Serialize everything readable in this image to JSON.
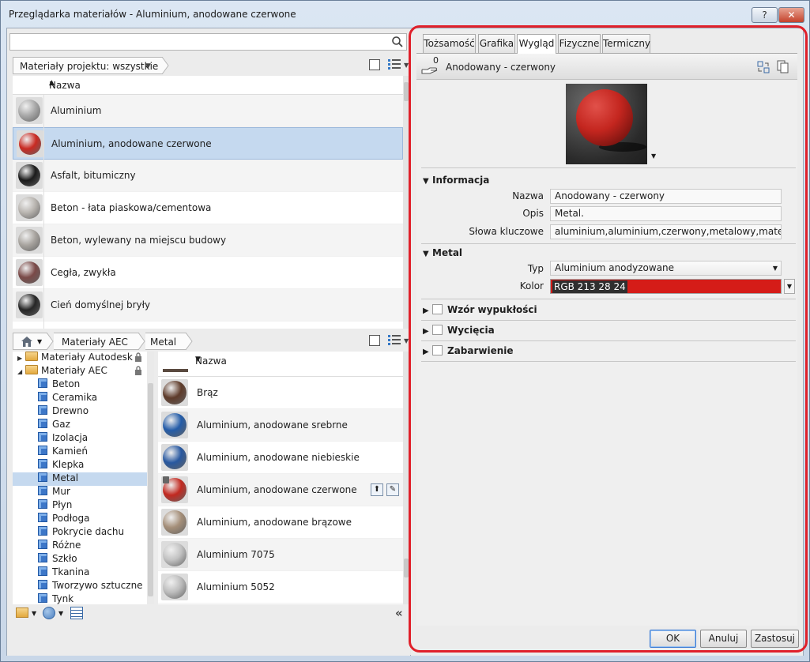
{
  "window": {
    "title": "Przeglądarka materiałów - Aluminium, anodowane czerwone",
    "help_label": "?",
    "close_label": "✕"
  },
  "search": {
    "placeholder": ""
  },
  "project_filter": {
    "label": "Materiały projektu: wszystkie"
  },
  "project_list": {
    "header": "Nazwa",
    "items": [
      {
        "label": "Aluminium",
        "swatch": "#a9a9a9"
      },
      {
        "label": "Aluminium, anodowane czerwone",
        "swatch": "#c92a22"
      },
      {
        "label": "Asfalt, bitumiczny",
        "swatch": "#1b1b1b"
      },
      {
        "label": "Beton - łata piaskowa/cementowa",
        "swatch": "#b9b5b0"
      },
      {
        "label": "Beton, wylewany na miejscu budowy",
        "swatch": "#a8a49f"
      },
      {
        "label": "Cegła, zwykła",
        "swatch": "#7a4a48"
      },
      {
        "label": "Cień domyślnej bryły",
        "swatch": "#262626"
      }
    ]
  },
  "library_crumbs": {
    "seg1": "Materiały AEC",
    "seg2": "Metal"
  },
  "tree": {
    "lib1": "Materiały Autodesk",
    "lib2": "Materiały AEC",
    "items": [
      "Beton",
      "Ceramika",
      "Drewno",
      "Gaz",
      "Izolacja",
      "Kamień",
      "Klepka",
      "Metal",
      "Mur",
      "Płyn",
      "Podłoga",
      "Pokrycie dachu",
      "Różne",
      "Szkło",
      "Tkanina",
      "Tworzywo sztuczne",
      "Tynk"
    ]
  },
  "library_list": {
    "header": "Nazwa",
    "items": [
      {
        "label": "Brąz",
        "swatch": "#5e3b2a"
      },
      {
        "label": "Aluminium, anodowane srebrne",
        "swatch": "#245ca8"
      },
      {
        "label": "Aluminium, anodowane niebieskie",
        "swatch": "#2858a0"
      },
      {
        "label": "Aluminium, anodowane czerwone",
        "swatch": "#c22920"
      },
      {
        "label": "Aluminium, anodowane brązowe",
        "swatch": "#a58f79"
      },
      {
        "label": "Aluminium 7075",
        "swatch": "#c3c3c3"
      },
      {
        "label": "Aluminium 5052",
        "swatch": "#bdbdbd"
      }
    ]
  },
  "tabs": [
    "Tożsamość",
    "Grafika",
    "Wygląd",
    "Fizyczne",
    "Termiczny"
  ],
  "asset": {
    "name": "Anodowany - czerwony",
    "count": "0"
  },
  "info_section": {
    "title": "Informacja",
    "name_label": "Nazwa",
    "name_value": "Anodowany - czerwony",
    "desc_label": "Opis",
    "desc_value": "Metal.",
    "kw_label": "Słowa kluczowe",
    "kw_value": "aluminium,aluminium,czerwony,metalowy,materiały"
  },
  "metal_section": {
    "title": "Metal",
    "type_label": "Typ",
    "type_value": "Aluminium anodyzowane",
    "color_label": "Kolor",
    "color_value": "RGB 213 28 24",
    "color_hex": "#d51c18"
  },
  "collapsed_sections": [
    "Wzór wypukłości",
    "Wycięcia",
    "Zabarwienie"
  ],
  "buttons": {
    "ok": "OK",
    "cancel": "Anuluj",
    "apply": "Zastosuj"
  }
}
